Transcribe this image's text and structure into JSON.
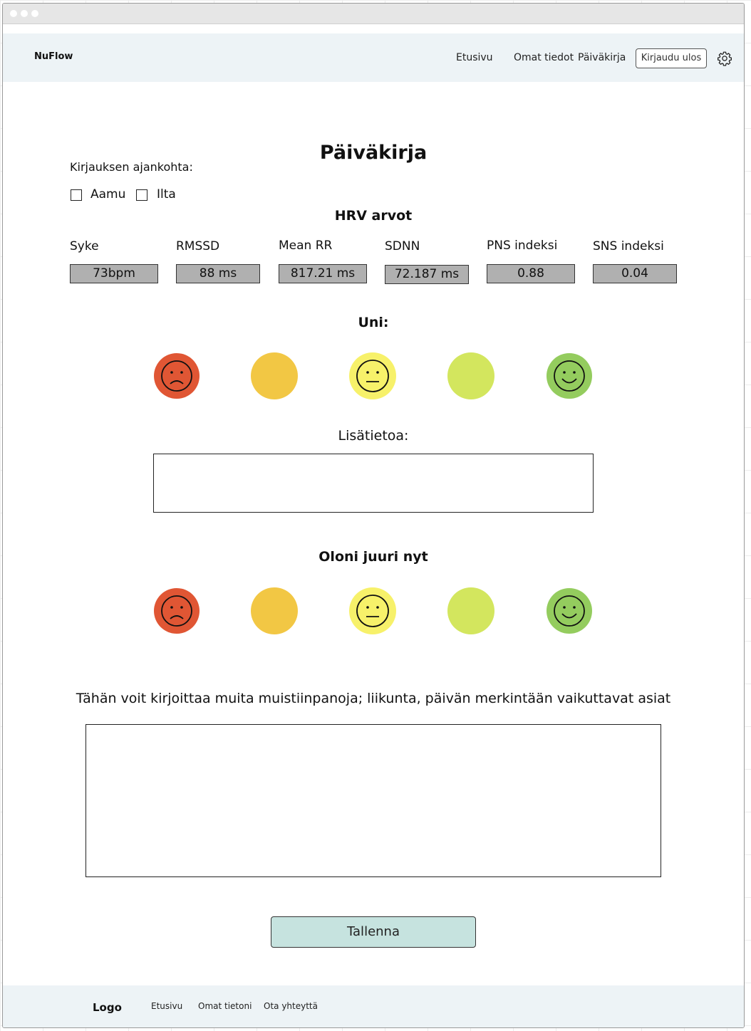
{
  "header": {
    "brand": "NuFlow",
    "nav": [
      "Etusivu",
      "Omat tiedot",
      "Päiväkirja"
    ],
    "logout_label": "Kirjaudu ulos"
  },
  "main": {
    "title": "Päiväkirja",
    "time_label": "Kirjauksen ajankohta:",
    "options": [
      "Aamu",
      "Ilta"
    ],
    "hrv_heading": "HRV arvot",
    "metrics": [
      {
        "label": "Syke",
        "value": "73bpm"
      },
      {
        "label": "RMSSD",
        "value": "88 ms"
      },
      {
        "label": "Mean RR",
        "value": "817.21 ms"
      },
      {
        "label": "SDNN",
        "value": "72.187 ms"
      },
      {
        "label": "PNS indeksi",
        "value": "0.88"
      },
      {
        "label": "SNS indeksi",
        "value": "0.04"
      }
    ],
    "sleep_heading": "Uni:",
    "extra_label": "Lisätietoa:",
    "mood_heading": "Oloni juuri nyt",
    "notes_label": "Tähän voit kirjoittaa muita muistiinpanoja; liikunta, päivän merkintään vaikuttavat asiat",
    "save_label": "Tallenna",
    "face_colors": [
      "#e05634",
      "#f2c744",
      "#f7f16a",
      "#d3e65e",
      "#94cc5e"
    ],
    "face_icons": [
      "sad-face-icon",
      "blank-face-icon",
      "neutral-face-icon",
      "blank-face-icon",
      "smiley-face-icon"
    ]
  },
  "footer": {
    "logo": "Logo",
    "links": [
      "Etusivu",
      "Omat tietoni",
      "Ota yhteyttä"
    ]
  }
}
